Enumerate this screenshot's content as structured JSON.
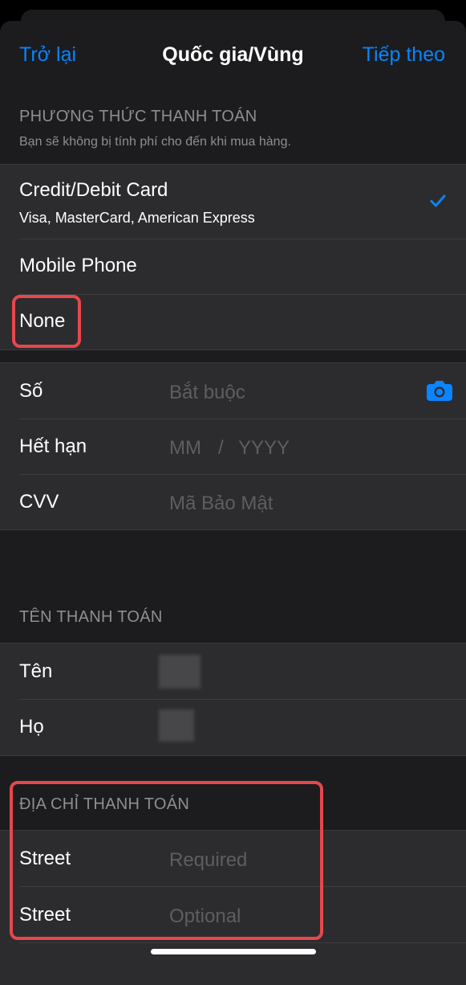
{
  "nav": {
    "back_label": "Trở lại",
    "title": "Quốc gia/Vùng",
    "next_label": "Tiếp theo"
  },
  "payment": {
    "header": "PHƯƠNG THỨC THANH TOÁN",
    "subtitle": "Bạn sẽ không bị tính phí cho đến khi mua hàng.",
    "options": [
      {
        "title": "Credit/Debit Card",
        "subtitle": "Visa, MasterCard, American Express",
        "selected": true
      },
      {
        "title": "Mobile Phone",
        "selected": false
      },
      {
        "title": "None",
        "selected": false
      }
    ]
  },
  "card": {
    "number_label": "Số",
    "number_placeholder": "Bắt buộc",
    "expiry_label": "Hết hạn",
    "expiry_month": "MM",
    "expiry_sep": "/",
    "expiry_year": "YYYY",
    "cvv_label": "CVV",
    "cvv_placeholder": "Mã Bảo Mật"
  },
  "billing_name": {
    "header": "TÊN THANH TOÁN",
    "first_label": "Tên",
    "last_label": "Họ"
  },
  "billing_address": {
    "header": "ĐỊA CHỈ THANH TOÁN",
    "street1_label": "Street",
    "street1_placeholder": "Required",
    "street2_label": "Street",
    "street2_placeholder": "Optional"
  },
  "colors": {
    "accent": "#0a84ff",
    "highlight": "#e5484d",
    "background": "#1c1c1e",
    "cell": "#2c2c2e"
  },
  "icons": {
    "selected": "checkmark-icon",
    "scan": "camera-icon"
  }
}
